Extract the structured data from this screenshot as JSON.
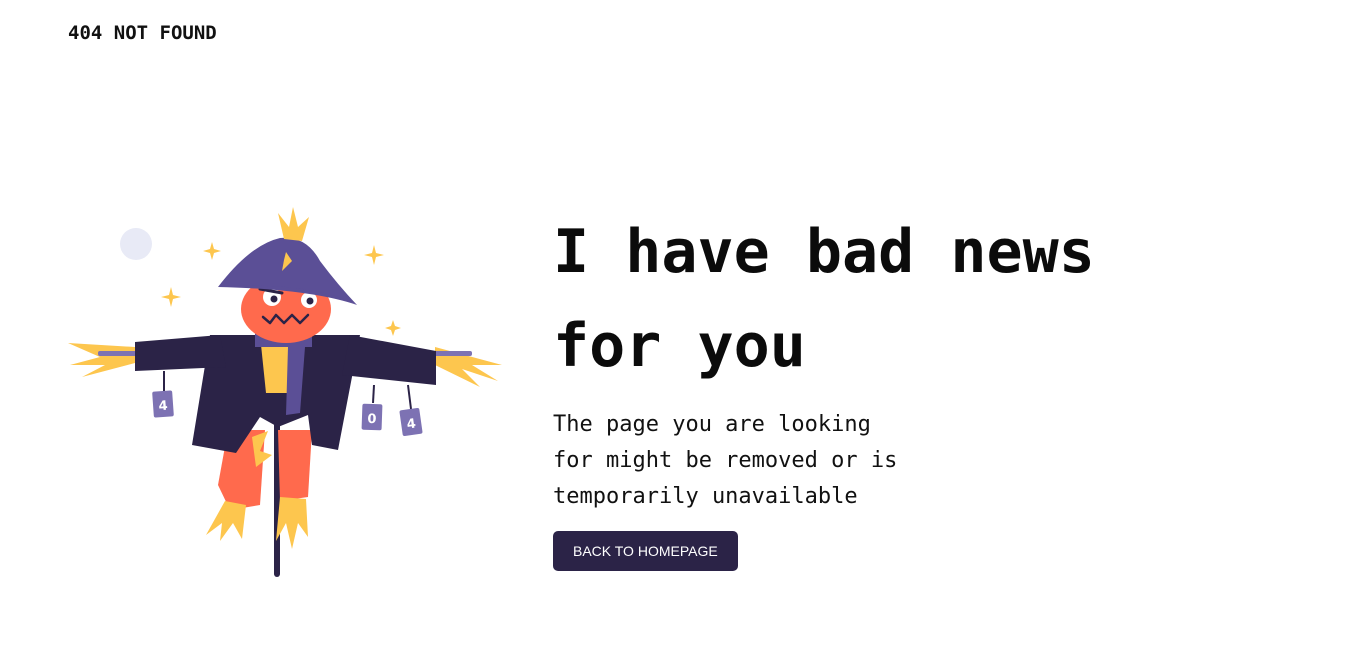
{
  "header": {
    "brand": "404 NOT FOUND"
  },
  "main": {
    "headline_line1": "I have bad news",
    "headline_line2": "for you",
    "description": "The page you are looking for might be removed or is temporarily unavailable",
    "cta_label": "BACK TO HOMEPAGE"
  },
  "illustration": {
    "cans": [
      "4",
      "0",
      "4"
    ]
  },
  "colors": {
    "button_bg": "#2b2347",
    "coat": "#2b2347",
    "hat": "#5b4f96",
    "pumpkin": "#ff6a4d",
    "straw": "#fdc64e",
    "can": "#7d72b3",
    "moon": "#e8eaf6"
  }
}
